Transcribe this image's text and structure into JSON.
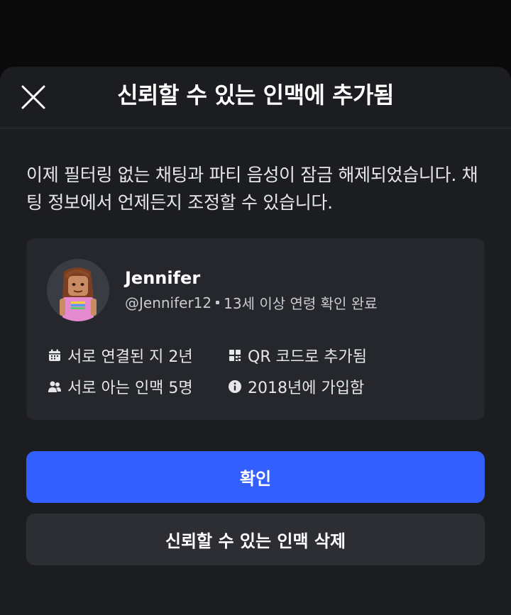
{
  "dialog": {
    "title": "신뢰할 수 있는 인맥에 추가됨",
    "description": "이제 필터링 없는 채팅과 파티 음성이 잠금 해제되었습니다. 채팅 정보에서 언제든지 조정할 수 있습니다."
  },
  "profile": {
    "name": "Jennifer",
    "username": "@Jennifer12",
    "verification": "13세 이상 연령 확인 완료"
  },
  "stats": {
    "connected": "서로 연결된 지 2년",
    "added_via": "QR 코드로 추가됨",
    "mutual": "서로 아는 인맥 5명",
    "joined": "2018년에 가입함"
  },
  "actions": {
    "confirm_label": "확인",
    "remove_label": "신뢰할 수 있는 인맥 삭제"
  },
  "colors": {
    "primary": "#335fff",
    "sheet_bg": "#1c1d21",
    "card_bg": "#26272c"
  }
}
